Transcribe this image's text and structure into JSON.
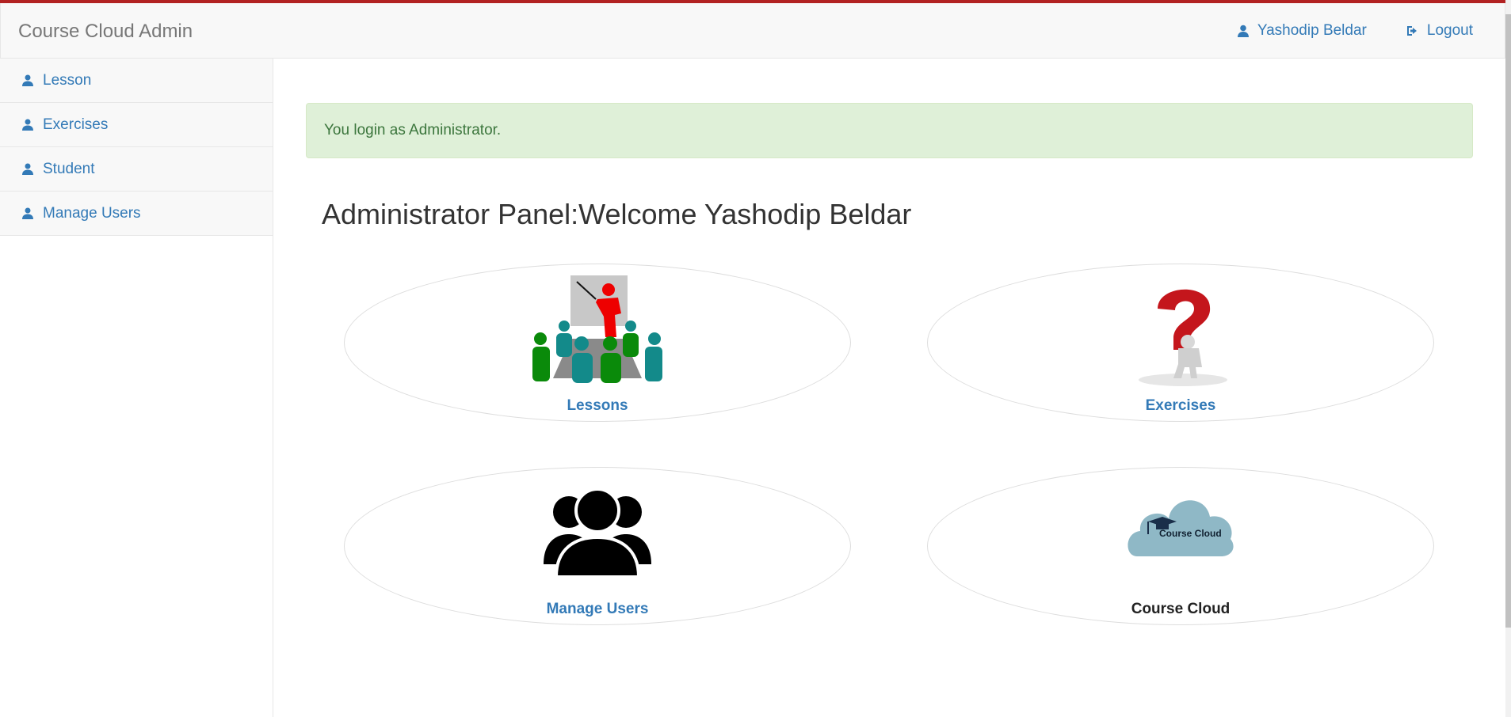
{
  "navbar": {
    "brand": "Course Cloud Admin",
    "user_name": "Yashodip Beldar",
    "logout_label": "Logout"
  },
  "sidebar": {
    "items": [
      {
        "label": "Lesson"
      },
      {
        "label": "Exercises"
      },
      {
        "label": "Student"
      },
      {
        "label": "Manage Users"
      }
    ]
  },
  "alert": {
    "message": "You login as Administrator."
  },
  "main": {
    "title": "Administrator Panel:Welcome Yashodip Beldar",
    "tiles": [
      {
        "label": "Lessons",
        "icon": "classroom-icon"
      },
      {
        "label": "Exercises",
        "icon": "question-mark-icon"
      },
      {
        "label": "Manage Users",
        "icon": "users-icon"
      },
      {
        "label": "Course Cloud",
        "icon": "cloud-logo-icon",
        "logo_text": "Course Cloud"
      }
    ]
  },
  "colors": {
    "link": "#337ab7",
    "accent_top": "#b22222",
    "alert_bg": "#dff0d8",
    "alert_text": "#3c763d"
  }
}
